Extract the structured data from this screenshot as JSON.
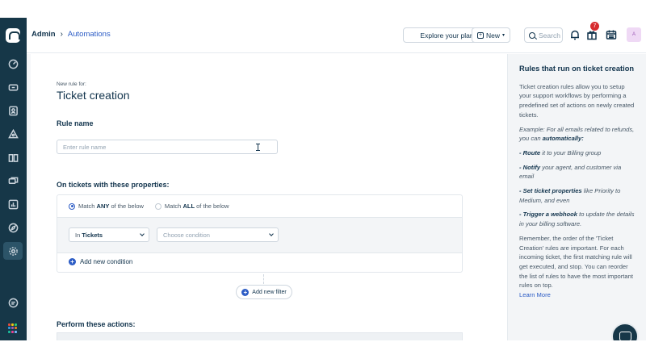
{
  "topbar": {
    "breadcrumb_root": "Admin",
    "breadcrumb_sep": "›",
    "breadcrumb_current": "Automations",
    "explore_label": "Explore your plan",
    "new_label": "New",
    "search_placeholder": "Search",
    "notification_count": "7",
    "avatar_initial": "A"
  },
  "sidebar": {
    "items": [
      "dashboard-icon",
      "tickets-icon",
      "contacts-icon",
      "groups-icon",
      "solutions-icon",
      "forums-icon",
      "reports-icon",
      "discovery-icon",
      "admin-gear-icon"
    ],
    "active": "admin-gear-icon",
    "bottom": [
      "chat-icon",
      "apps-grid-icon"
    ]
  },
  "form": {
    "kicker": "New rule for:",
    "title": "Ticket creation",
    "rule_name_label": "Rule name",
    "rule_name_placeholder": "Enter rule name",
    "properties_label": "On tickets with these properties:",
    "match_any_prefix": "Match",
    "match_any_bold": "ANY",
    "match_any_suffix": "of the below",
    "match_all_prefix": "Match",
    "match_all_bold": "ALL",
    "match_all_suffix": "of the below",
    "scope_prefix": "In",
    "scope_value": "Tickets",
    "condition_placeholder": "Choose condition",
    "add_condition": "Add new condition",
    "add_filter": "Add new filter",
    "actions_label": "Perform these actions:"
  },
  "help": {
    "title": "Rules that run on ticket creation",
    "intro": "Ticket creation rules allow you to setup your support workflows by performing a predefined set of actions on newly created tickets.",
    "example_prefix": "Example: For all emails related to refunds, you can",
    "example_bold": "automatically:",
    "b1_bold": "- Route",
    "b1_text": "it to your Billing group",
    "b2_bold": "- Notify",
    "b2_text": "your agent, and customer via email",
    "b3_bold": "- Set ticket properties",
    "b3_text": "like Priority to Medium, and even",
    "b4_bold": "- Trigger a webhook",
    "b4_text": "to update the details in your billing software.",
    "remember": "Remember, the order of the 'Ticket Creation' rules are important. For each incoming ticket, the first matching rule will get executed, and stop. You can reorder the list of rules to have the most important rules on top.",
    "learn_more": "Learn More"
  },
  "colors": {
    "sidebar": "#163748",
    "accent": "#2c5cc5",
    "badge": "#d72d30"
  }
}
